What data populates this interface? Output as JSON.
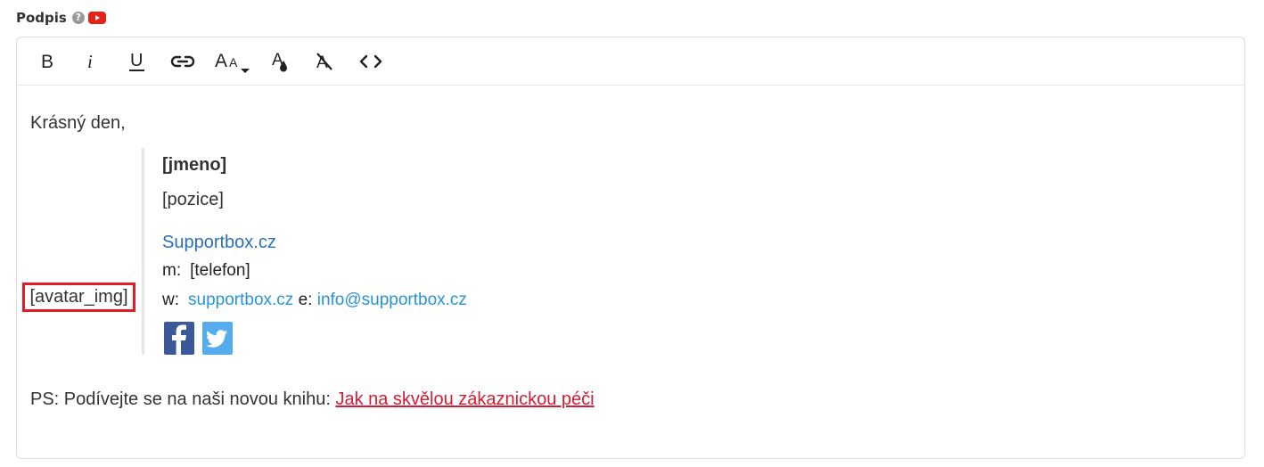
{
  "field": {
    "label": "Podpis",
    "help_icon": "?"
  },
  "toolbar": {
    "buttons": [
      {
        "name": "bold",
        "icon": "bold-icon"
      },
      {
        "name": "italic",
        "icon": "italic-icon"
      },
      {
        "name": "underline",
        "icon": "underline-icon"
      },
      {
        "name": "link",
        "icon": "link-icon"
      },
      {
        "name": "font-size",
        "icon": "font-size-icon"
      },
      {
        "name": "text-color",
        "icon": "text-color-icon"
      },
      {
        "name": "clear-formatting",
        "icon": "clear-formatting-icon"
      },
      {
        "name": "source-code",
        "icon": "code-icon"
      }
    ]
  },
  "content": {
    "greeting": "Krásný den,",
    "avatar_placeholder": "[avatar_img]",
    "signature": {
      "name": "[jmeno]",
      "position": "[pozice]",
      "company_link": "Supportbox.cz",
      "phone_label": "m:",
      "phone_value": "[telefon]",
      "web_label": "w:",
      "web_link": "supportbox.cz",
      "email_label": "e:",
      "email_link": "info@supportbox.cz",
      "social": [
        {
          "name": "facebook",
          "icon": "facebook-icon",
          "color": "#3b5998"
        },
        {
          "name": "twitter",
          "icon": "twitter-icon",
          "color": "#55acee"
        }
      ]
    },
    "ps_text": "PS: Podívejte se na naši novou knihu:",
    "ps_link": "Jak na skvělou zákaznickou péči"
  },
  "colors": {
    "avatar_border": "#e21b2a",
    "link_blue": "#2a93d5",
    "company_blue": "#2a6fb8",
    "ps_link_red": "#d81b33",
    "youtube_red": "#e62117"
  }
}
